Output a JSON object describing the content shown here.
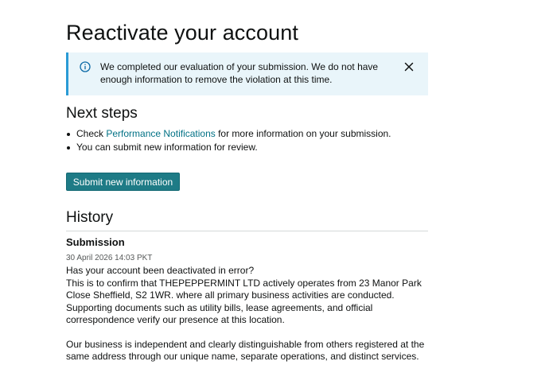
{
  "page": {
    "title": "Reactivate your account"
  },
  "alert": {
    "icon": "info-icon",
    "message": "We completed our evaluation of your submission. We do not have enough in­formation to remove the violation at this time.",
    "close_icon": "close-icon"
  },
  "next_steps": {
    "heading": "Next steps",
    "item1_prefix": "Check ",
    "item1_link": "Performance Notifications",
    "item1_suffix": " for more information on your submission.",
    "item2": "You can submit new information for review."
  },
  "submit_button": {
    "label": "Submit new information"
  },
  "history": {
    "heading": "History",
    "submission_title": "Submission",
    "date": "30 April 2026 14:03 PKT",
    "question": "Has your account been deactivated in error?",
    "paragraph1": "This is to confirm that THEPEPPERMINT LTD actively operates from 23 Manor Park Close Sheffield, S2 1WR. where all primary business activities are conducted. Supporting documents such as utility bills, lease agreements, and official correspondence verify our presence at this location.",
    "paragraph2": "Our business is independent and clearly distinguishable from others registered at the same address through our unique name, separate operations, and distinct services."
  },
  "colors": {
    "accent_link": "#007185",
    "button_bg": "#1e7b86",
    "alert_bg": "#e9f5fa",
    "alert_border": "#2a9bd5"
  }
}
